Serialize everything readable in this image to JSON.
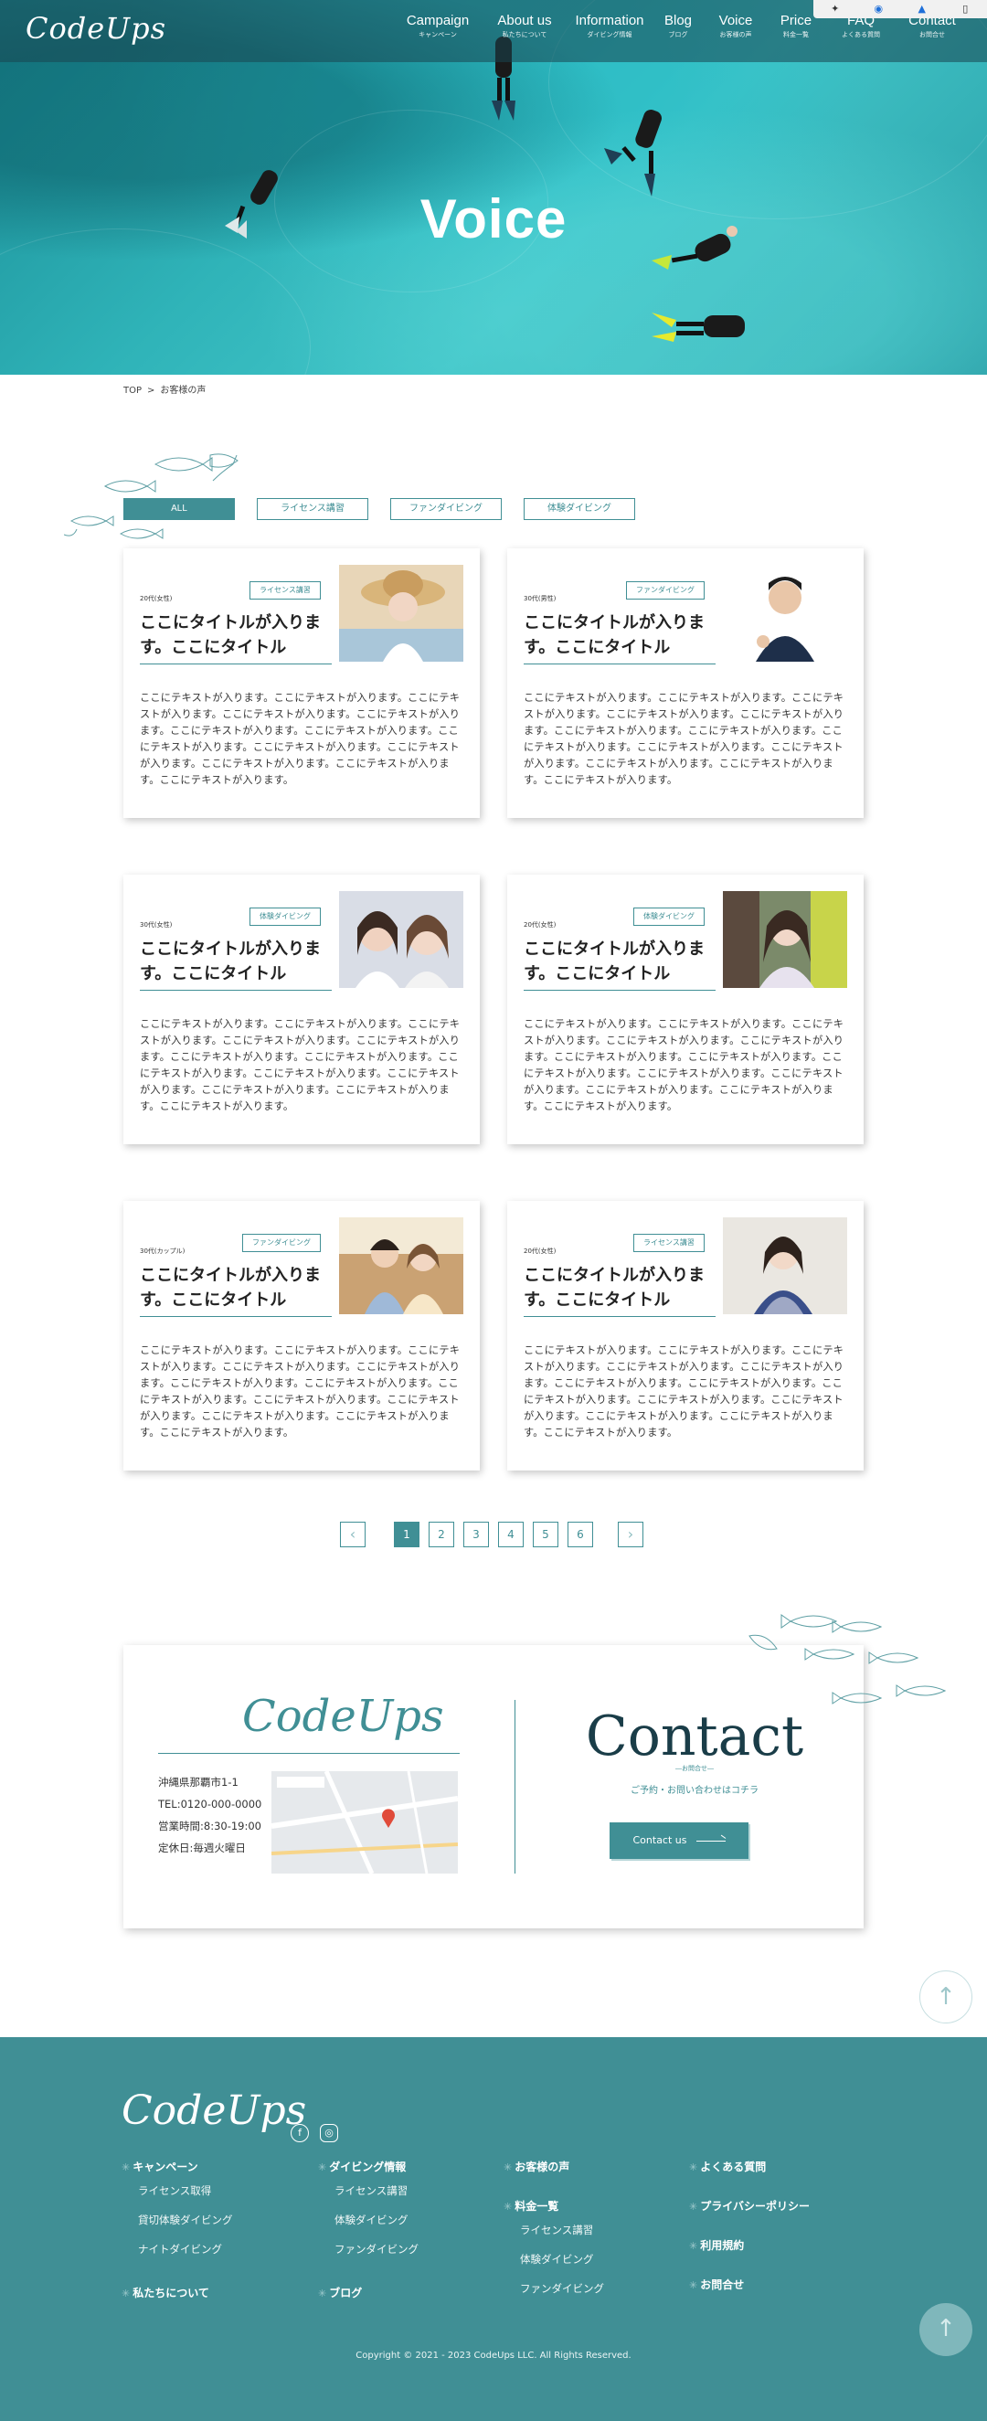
{
  "header": {
    "logo": "CodeUps",
    "nav": [
      {
        "en": "Campaign",
        "ja": "キャンペーン"
      },
      {
        "en": "About us",
        "ja": "私たちについて"
      },
      {
        "en": "Information",
        "ja": "ダイビング情報"
      },
      {
        "en": "Blog",
        "ja": "ブログ"
      },
      {
        "en": "Voice",
        "ja": "お客様の声"
      },
      {
        "en": "Price",
        "ja": "料金一覧"
      },
      {
        "en": "FAQ",
        "ja": "よくある質問"
      },
      {
        "en": "Contact",
        "ja": "お問合せ"
      }
    ]
  },
  "hero": {
    "title": "Voice"
  },
  "breadcrumb": {
    "home": "TOP",
    "separator": ">",
    "current": "お客様の声"
  },
  "filters": [
    "ALL",
    "ライセンス講習",
    "ファンダイビング",
    "体験ダイビング"
  ],
  "cards": [
    {
      "meta": "20代(女性)",
      "tag": "ライセンス講習",
      "title": "ここにタイトルが入りま す。ここにタイトル",
      "text": "ここにテキストが入ります。ここにテキストが入ります。ここにテキストが入ります。ここにテキストが入ります。ここにテキストが入ります。ここにテキストが入ります。ここにテキストが入ります。ここにテキストが入ります。ここにテキストが入ります。ここにテキストが入ります。ここにテキストが入ります。ここにテキストが入ります。ここにテキストが入ります。"
    },
    {
      "meta": "30代(男性)",
      "tag": "ファンダイビング",
      "title": "ここにタイトルが入りま す。ここにタイトル",
      "text": "ここにテキストが入ります。ここにテキストが入ります。ここにテキストが入ります。ここにテキストが入ります。ここにテキストが入ります。ここにテキストが入ります。ここにテキストが入ります。ここにテキストが入ります。ここにテキストが入ります。ここにテキストが入ります。ここにテキストが入ります。ここにテキストが入ります。ここにテキストが入ります。"
    },
    {
      "meta": "30代(女性)",
      "tag": "体験ダイビング",
      "title": "ここにタイトルが入りま す。ここにタイトル",
      "text": "ここにテキストが入ります。ここにテキストが入ります。ここにテキストが入ります。ここにテキストが入ります。ここにテキストが入ります。ここにテキストが入ります。ここにテキストが入ります。ここにテキストが入ります。ここにテキストが入ります。ここにテキストが入ります。ここにテキストが入ります。ここにテキストが入ります。ここにテキストが入ります。"
    },
    {
      "meta": "20代(女性)",
      "tag": "体験ダイビング",
      "title": "ここにタイトルが入りま す。ここにタイトル",
      "text": "ここにテキストが入ります。ここにテキストが入ります。ここにテキストが入ります。ここにテキストが入ります。ここにテキストが入ります。ここにテキストが入ります。ここにテキストが入ります。ここにテキストが入ります。ここにテキストが入ります。ここにテキストが入ります。ここにテキストが入ります。ここにテキストが入ります。ここにテキストが入ります。"
    },
    {
      "meta": "30代(カップル)",
      "tag": "ファンダイビング",
      "title": "ここにタイトルが入りま す。ここにタイトル",
      "text": "ここにテキストが入ります。ここにテキストが入ります。ここにテキストが入ります。ここにテキストが入ります。ここにテキストが入ります。ここにテキストが入ります。ここにテキストが入ります。ここにテキストが入ります。ここにテキストが入ります。ここにテキストが入ります。ここにテキストが入ります。ここにテキストが入ります。ここにテキストが入ります。"
    },
    {
      "meta": "20代(女性)",
      "tag": "ライセンス講習",
      "title": "ここにタイトルが入りま す。ここにタイトル",
      "text": "ここにテキストが入ります。ここにテキストが入ります。ここにテキストが入ります。ここにテキストが入ります。ここにテキストが入ります。ここにテキストが入ります。ここにテキストが入ります。ここにテキストが入ります。ここにテキストが入ります。ここにテキストが入ります。ここにテキストが入ります。ここにテキストが入ります。ここにテキストが入ります。"
    }
  ],
  "pagination": {
    "prev": "‹",
    "next": "›",
    "pages": [
      "1",
      "2",
      "3",
      "4",
      "5",
      "6"
    ],
    "current": "1"
  },
  "contact": {
    "logo": "CodeUps",
    "address": [
      "沖縄県那覇市1-1",
      "TEL:0120-000-0000",
      "営業時間:8:30-19:00",
      "定休日:毎週火曜日"
    ],
    "title": "Contact",
    "subtitle": "―お問合せ―",
    "lead": "ご予約・お問い合わせはコチラ",
    "button": "Contact us"
  },
  "footer": {
    "logo": "CodeUps",
    "columns": [
      {
        "head": "キャンペーン",
        "items": [
          "ライセンス取得",
          "貸切体験ダイビング",
          "ナイトダイビング"
        ]
      },
      {
        "head": "私たちについて",
        "items": []
      },
      {
        "head": "ダイビング情報",
        "items": [
          "ライセンス講習",
          "体験ダイビング",
          "ファンダイビング"
        ]
      },
      {
        "head": "ブログ",
        "items": []
      },
      {
        "head": "お客様の声",
        "items": []
      },
      {
        "head": "料金一覧",
        "items": [
          "ライセンス講習",
          "体験ダイビング",
          "ファンダイビング"
        ]
      },
      {
        "head": "よくある質問",
        "items": []
      },
      {
        "head": "プライバシーポリシー",
        "items": []
      },
      {
        "head": "利用規約",
        "items": []
      },
      {
        "head": "お問合せ",
        "items": []
      }
    ],
    "copyright": "Copyright © 2021 - 2023 CodeUps LLC. All Rights Reserved."
  },
  "colors": {
    "accent": "#408f95",
    "footer_bg": "#408f95"
  }
}
